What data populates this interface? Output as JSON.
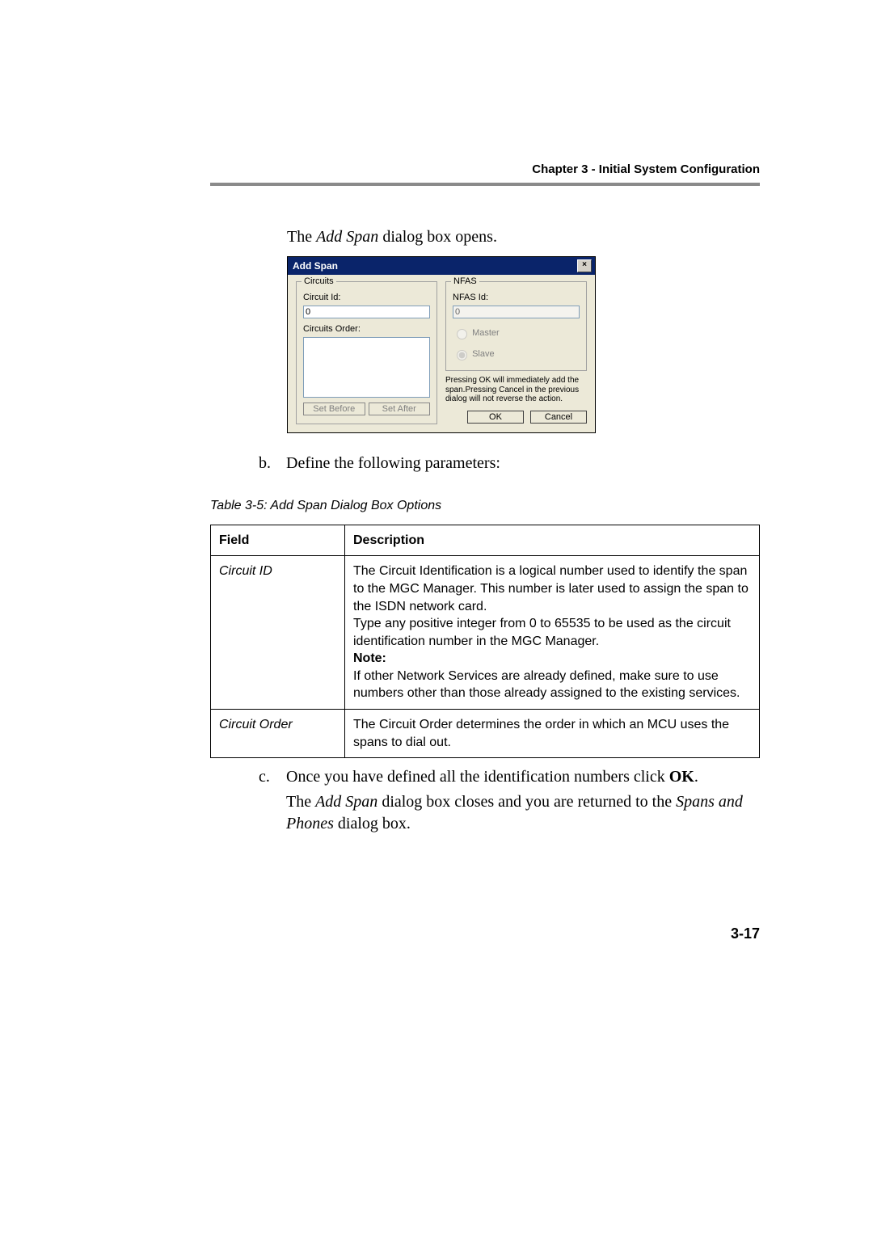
{
  "header": {
    "chapter": "Chapter 3 - Initial System Configuration"
  },
  "intro_sentence_prefix": "The ",
  "intro_sentence_italic": "Add Span",
  "intro_sentence_suffix": " dialog box opens.",
  "dialog": {
    "title": "Add Span",
    "close_glyph": "×",
    "circuits_legend": "Circuits",
    "circuit_id_label": "Circuit Id:",
    "circuit_id_value": "0",
    "circuits_order_label": "Circuits Order:",
    "set_before_label": "Set Before",
    "set_after_label": "Set After",
    "nfas_legend": "NFAS",
    "nfas_id_label": "NFAS Id:",
    "nfas_id_value": "0",
    "master_label": "Master",
    "slave_label": "Slave",
    "warning": "Pressing OK will immediately add the span.Pressing Cancel in the previous dialog will not reverse the action.",
    "ok_label": "OK",
    "cancel_label": "Cancel"
  },
  "step_b": {
    "marker": "b.",
    "text": "Define the following parameters:"
  },
  "table_caption": "Table 3-5: Add Span Dialog Box Options",
  "table_headers": {
    "field": "Field",
    "desc": "Description"
  },
  "table_rows": {
    "circuit_id": {
      "field": "Circuit ID",
      "p1": "The Circuit Identification is a logical number used to identify the span to the MGC Manager. This number is later used to assign the span to the ISDN network card.",
      "p2": "Type any positive integer from 0 to 65535 to be used as the circuit identification number in the MGC Manager.",
      "note_label": "Note:",
      "note": "If other Network Services are already defined, make sure to use numbers other than those already assigned to the existing services."
    },
    "circuit_order": {
      "field": "Circuit Order",
      "desc": "The Circuit Order determines the order in which an MCU uses the spans to dial out."
    }
  },
  "step_c": {
    "marker": "c.",
    "line1_prefix": "Once you have defined all the identification numbers click ",
    "line1_bold": "OK",
    "line1_suffix": ".",
    "line2_p1": "The ",
    "line2_it1": "Add Span",
    "line2_p2": " dialog box closes and you are returned to the ",
    "line2_it2": "Spans and Phones",
    "line2_p3": " dialog box."
  },
  "page_number": "3-17"
}
